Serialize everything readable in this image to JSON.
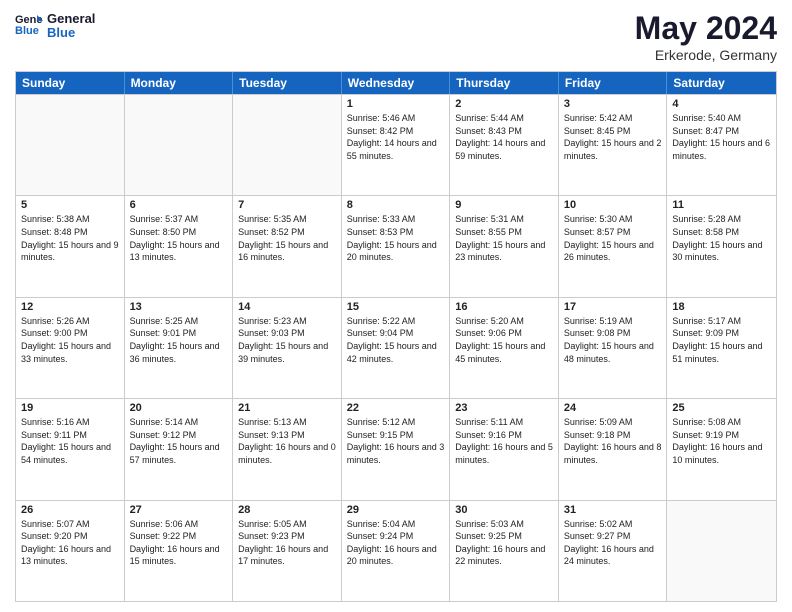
{
  "header": {
    "logo_line1": "General",
    "logo_line2": "Blue",
    "month": "May 2024",
    "location": "Erkerode, Germany"
  },
  "days_of_week": [
    "Sunday",
    "Monday",
    "Tuesday",
    "Wednesday",
    "Thursday",
    "Friday",
    "Saturday"
  ],
  "weeks": [
    [
      {
        "day": "",
        "empty": true
      },
      {
        "day": "",
        "empty": true
      },
      {
        "day": "",
        "empty": true
      },
      {
        "day": "1",
        "sunrise": "5:46 AM",
        "sunset": "8:42 PM",
        "daylight": "14 hours and 55 minutes."
      },
      {
        "day": "2",
        "sunrise": "5:44 AM",
        "sunset": "8:43 PM",
        "daylight": "14 hours and 59 minutes."
      },
      {
        "day": "3",
        "sunrise": "5:42 AM",
        "sunset": "8:45 PM",
        "daylight": "15 hours and 2 minutes."
      },
      {
        "day": "4",
        "sunrise": "5:40 AM",
        "sunset": "8:47 PM",
        "daylight": "15 hours and 6 minutes."
      }
    ],
    [
      {
        "day": "5",
        "sunrise": "5:38 AM",
        "sunset": "8:48 PM",
        "daylight": "15 hours and 9 minutes."
      },
      {
        "day": "6",
        "sunrise": "5:37 AM",
        "sunset": "8:50 PM",
        "daylight": "15 hours and 13 minutes."
      },
      {
        "day": "7",
        "sunrise": "5:35 AM",
        "sunset": "8:52 PM",
        "daylight": "15 hours and 16 minutes."
      },
      {
        "day": "8",
        "sunrise": "5:33 AM",
        "sunset": "8:53 PM",
        "daylight": "15 hours and 20 minutes."
      },
      {
        "day": "9",
        "sunrise": "5:31 AM",
        "sunset": "8:55 PM",
        "daylight": "15 hours and 23 minutes."
      },
      {
        "day": "10",
        "sunrise": "5:30 AM",
        "sunset": "8:57 PM",
        "daylight": "15 hours and 26 minutes."
      },
      {
        "day": "11",
        "sunrise": "5:28 AM",
        "sunset": "8:58 PM",
        "daylight": "15 hours and 30 minutes."
      }
    ],
    [
      {
        "day": "12",
        "sunrise": "5:26 AM",
        "sunset": "9:00 PM",
        "daylight": "15 hours and 33 minutes."
      },
      {
        "day": "13",
        "sunrise": "5:25 AM",
        "sunset": "9:01 PM",
        "daylight": "15 hours and 36 minutes."
      },
      {
        "day": "14",
        "sunrise": "5:23 AM",
        "sunset": "9:03 PM",
        "daylight": "15 hours and 39 minutes."
      },
      {
        "day": "15",
        "sunrise": "5:22 AM",
        "sunset": "9:04 PM",
        "daylight": "15 hours and 42 minutes."
      },
      {
        "day": "16",
        "sunrise": "5:20 AM",
        "sunset": "9:06 PM",
        "daylight": "15 hours and 45 minutes."
      },
      {
        "day": "17",
        "sunrise": "5:19 AM",
        "sunset": "9:08 PM",
        "daylight": "15 hours and 48 minutes."
      },
      {
        "day": "18",
        "sunrise": "5:17 AM",
        "sunset": "9:09 PM",
        "daylight": "15 hours and 51 minutes."
      }
    ],
    [
      {
        "day": "19",
        "sunrise": "5:16 AM",
        "sunset": "9:11 PM",
        "daylight": "15 hours and 54 minutes."
      },
      {
        "day": "20",
        "sunrise": "5:14 AM",
        "sunset": "9:12 PM",
        "daylight": "15 hours and 57 minutes."
      },
      {
        "day": "21",
        "sunrise": "5:13 AM",
        "sunset": "9:13 PM",
        "daylight": "16 hours and 0 minutes."
      },
      {
        "day": "22",
        "sunrise": "5:12 AM",
        "sunset": "9:15 PM",
        "daylight": "16 hours and 3 minutes."
      },
      {
        "day": "23",
        "sunrise": "5:11 AM",
        "sunset": "9:16 PM",
        "daylight": "16 hours and 5 minutes."
      },
      {
        "day": "24",
        "sunrise": "5:09 AM",
        "sunset": "9:18 PM",
        "daylight": "16 hours and 8 minutes."
      },
      {
        "day": "25",
        "sunrise": "5:08 AM",
        "sunset": "9:19 PM",
        "daylight": "16 hours and 10 minutes."
      }
    ],
    [
      {
        "day": "26",
        "sunrise": "5:07 AM",
        "sunset": "9:20 PM",
        "daylight": "16 hours and 13 minutes."
      },
      {
        "day": "27",
        "sunrise": "5:06 AM",
        "sunset": "9:22 PM",
        "daylight": "16 hours and 15 minutes."
      },
      {
        "day": "28",
        "sunrise": "5:05 AM",
        "sunset": "9:23 PM",
        "daylight": "16 hours and 17 minutes."
      },
      {
        "day": "29",
        "sunrise": "5:04 AM",
        "sunset": "9:24 PM",
        "daylight": "16 hours and 20 minutes."
      },
      {
        "day": "30",
        "sunrise": "5:03 AM",
        "sunset": "9:25 PM",
        "daylight": "16 hours and 22 minutes."
      },
      {
        "day": "31",
        "sunrise": "5:02 AM",
        "sunset": "9:27 PM",
        "daylight": "16 hours and 24 minutes."
      },
      {
        "day": "",
        "empty": true
      }
    ]
  ]
}
